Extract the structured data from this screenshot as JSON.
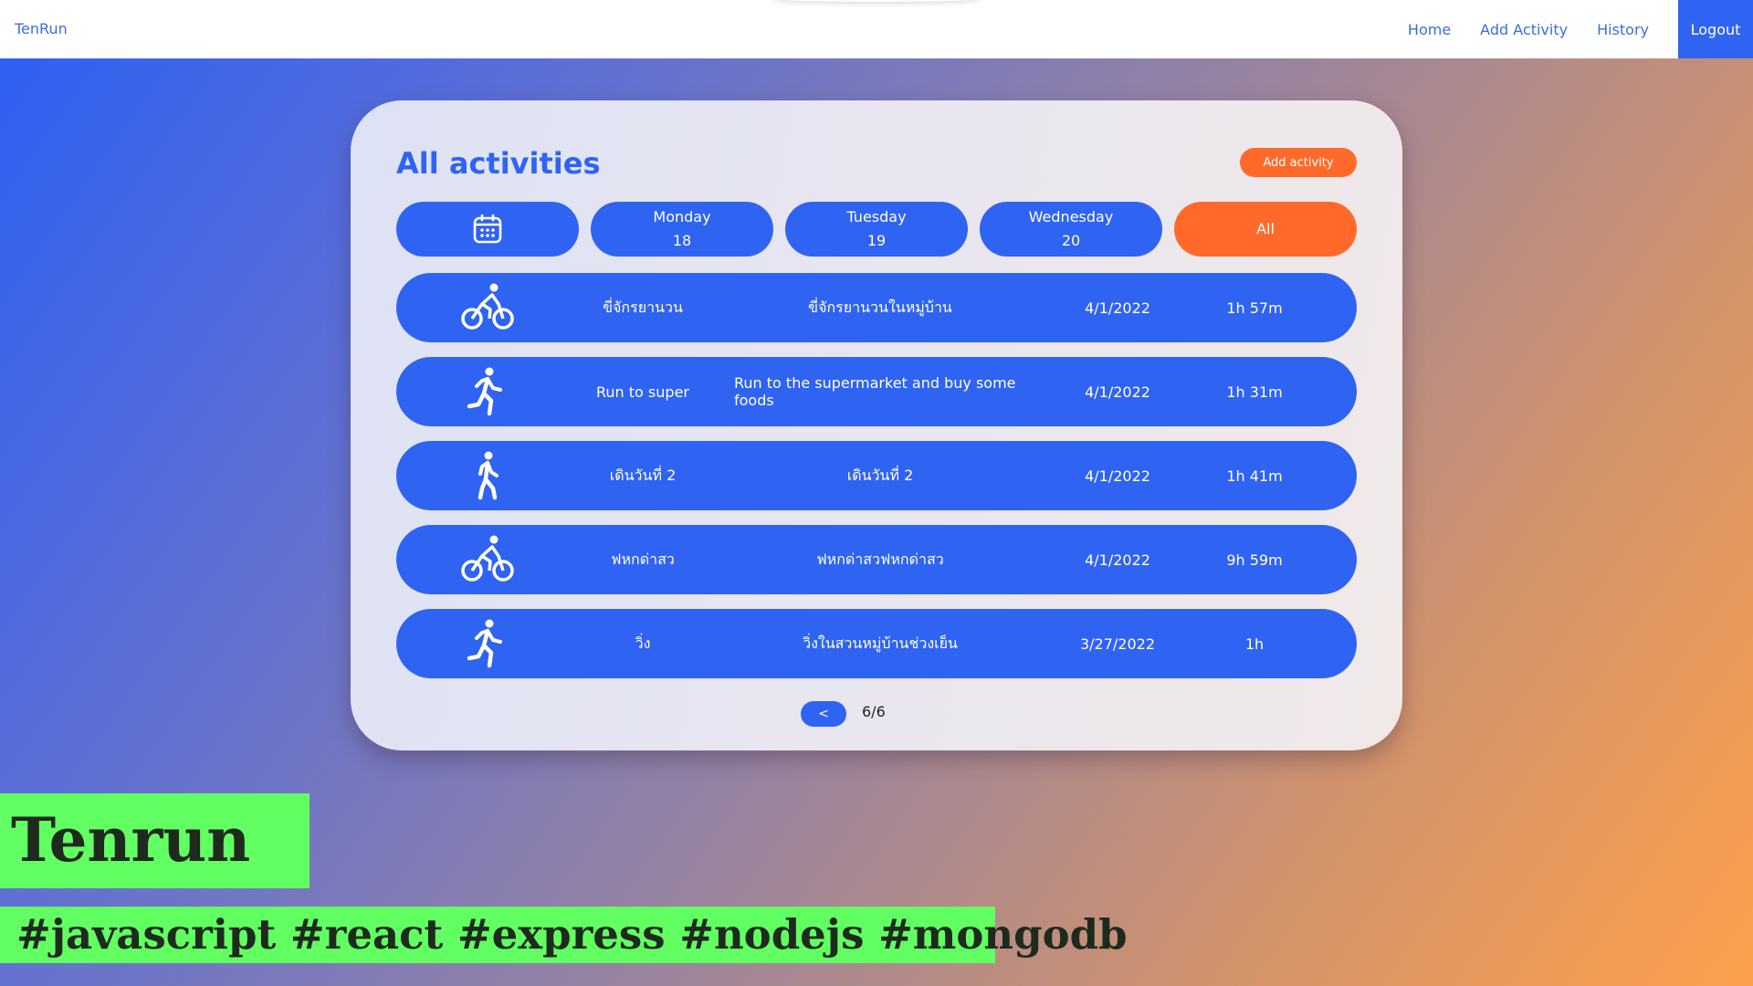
{
  "navbar": {
    "brand": "TenRun",
    "links": [
      "Home",
      "Add Activity",
      "History"
    ],
    "logout": "Logout"
  },
  "main": {
    "title": "All activities",
    "add_button": "Add activity",
    "filters": {
      "calendar_icon": "calendar-icon",
      "days": [
        {
          "day": "Monday",
          "date": "18"
        },
        {
          "day": "Tuesday",
          "date": "19"
        },
        {
          "day": "Wednesday",
          "date": "20"
        }
      ],
      "all": "All"
    },
    "activities": [
      {
        "icon": "bike-icon",
        "name": "ขี่จักรยานวน",
        "description": "ขี่จักรยานวนในหมู่บ้าน",
        "date": "4/1/2022",
        "duration": "1h 57m"
      },
      {
        "icon": "run-icon",
        "name": "Run to super",
        "description": "Run to the supermarket and buy some foods",
        "date": "4/1/2022",
        "duration": "1h 31m"
      },
      {
        "icon": "walk-icon",
        "name": "เดินวันที่ 2",
        "description": "เดินวันที่ 2",
        "date": "4/1/2022",
        "duration": "1h 41m"
      },
      {
        "icon": "bike-icon",
        "name": "ฟหกด่าสว",
        "description": "ฟหกด่าสวฟหกด่าสว",
        "date": "4/1/2022",
        "duration": "9h 59m"
      },
      {
        "icon": "run-icon",
        "name": "วิ่ง",
        "description": "วิ่งในสวนหมู่บ้านช่วงเย็น",
        "date": "3/27/2022",
        "duration": "1h"
      }
    ],
    "pager": {
      "prev": "<",
      "page": "6/6"
    }
  },
  "overlay": {
    "title": "Tenrun",
    "tags": "#javascript #react #express #nodejs #mongodb"
  },
  "colors": {
    "primary": "#2f63f2",
    "accent": "#ff6a2b",
    "highlight": "#62ff62"
  }
}
